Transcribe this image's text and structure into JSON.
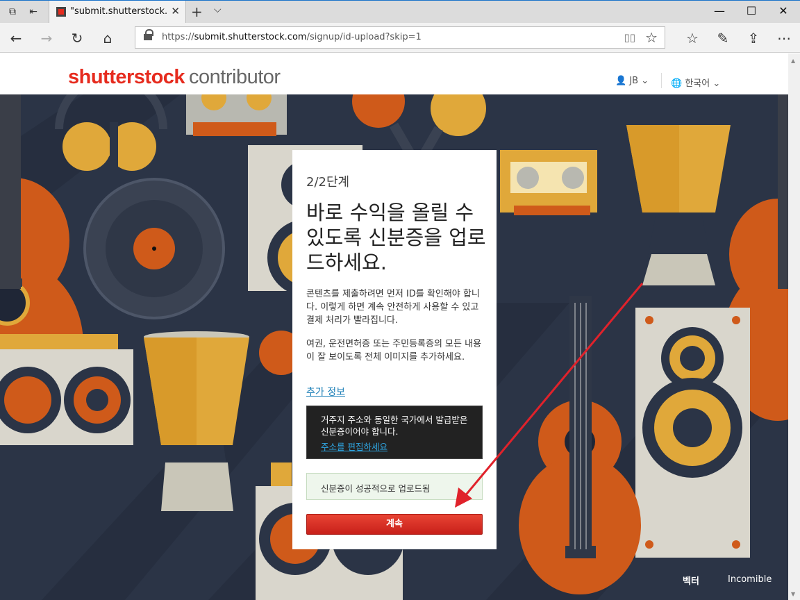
{
  "browser": {
    "tab_title": "\"submit.shutterstock.co",
    "url_prefix": "https://",
    "url_domain": "submit.shutterstock.com",
    "url_path": "/signup/id-upload?skip=1"
  },
  "header": {
    "logo_brand": "shutterstock",
    "logo_sub": "contributor",
    "user": "JB",
    "language": "한국어"
  },
  "card": {
    "step": "2/2단계",
    "heading": "바로 수익을 올릴 수 있도록 신분증을 업로드하세요.",
    "para1": "콘텐츠를 제출하려면 먼저 ID를 확인해야 합니다. 이렇게 하면 계속 안전하게 사용할 수 있고 결제 처리가 빨라집니다.",
    "para2": "여권, 운전면허증 또는 주민등록증의 모든 내용이 잘 보이도록 전체 이미지를 추가하세요.",
    "more_info": "추가 정보",
    "notice_text": "거주지 주소와 동일한 국가에서 발급받은 신분증이어야 합니다.",
    "notice_link": "주소를 편집하세요",
    "success": "신분증이 성공적으로 업로드됨",
    "continue": "계속"
  },
  "credit": {
    "vector": "벡터",
    "author": "Incomible"
  },
  "colors": {
    "brand_red": "#e62b1e",
    "hero_bg": "#2b3446",
    "link_blue": "#1c7fb7",
    "annotation_arrow": "#e0222b"
  }
}
